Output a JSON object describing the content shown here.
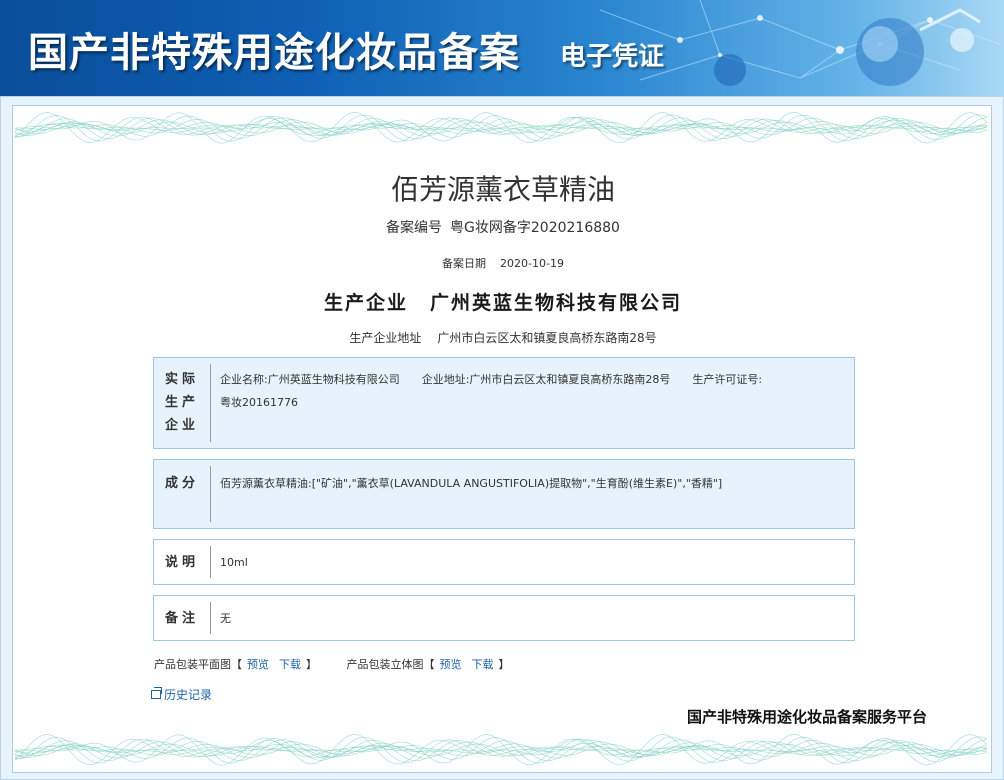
{
  "banner": {
    "title": "国产非特殊用途化妆品备案",
    "subtitle": "电子凭证"
  },
  "product": {
    "name": "佰芳源薰衣草精油",
    "record_no_label": "备案编号",
    "record_no": "粤G妆网备字2020216880",
    "record_date_label": "备案日期",
    "record_date": "2020-10-19",
    "producer_label": "生产企业",
    "producer": "广州英蓝生物科技有限公司",
    "producer_addr_label": "生产企业地址",
    "producer_addr": "广州市白云区太和镇夏良高桥东路南28号"
  },
  "actual_producer": {
    "label_lines": [
      "实际",
      "生产",
      "企业"
    ],
    "name_segment": "企业名称:广州英蓝生物科技有限公司",
    "address_segment": "企业地址:广州市白云区太和镇夏良高桥东路南28号",
    "license_segment": "生产许可证号:",
    "license_value": "粤妆20161776"
  },
  "ingredients": {
    "label": "成分",
    "value": "佰芳源薰衣草精油:[\"矿油\",\"薰衣草(LAVANDULA ANGUSTIFOLIA)提取物\",\"生育酚(维生素E)\",\"香精\"]"
  },
  "description": {
    "label": "说明",
    "value": "10ml"
  },
  "remarks": {
    "label": "备注",
    "value": "无"
  },
  "packaging": {
    "flat_label": "产品包装平面图",
    "stereo_label": "产品包装立体图",
    "preview": "预览",
    "download": "下载",
    "bracket_open": "【",
    "bracket_close": "】"
  },
  "history_link": "历史记录",
  "platform_name": "国产非特殊用途化妆品备案服务平台",
  "colors": {
    "banner_dark": "#0a4d9a",
    "banner_light": "#a9d8f5",
    "box_blue_bg": "#e6f3fc",
    "box_border": "#9cc9e6",
    "link": "#1e62a8",
    "guilloche": "#7fcfc0"
  }
}
